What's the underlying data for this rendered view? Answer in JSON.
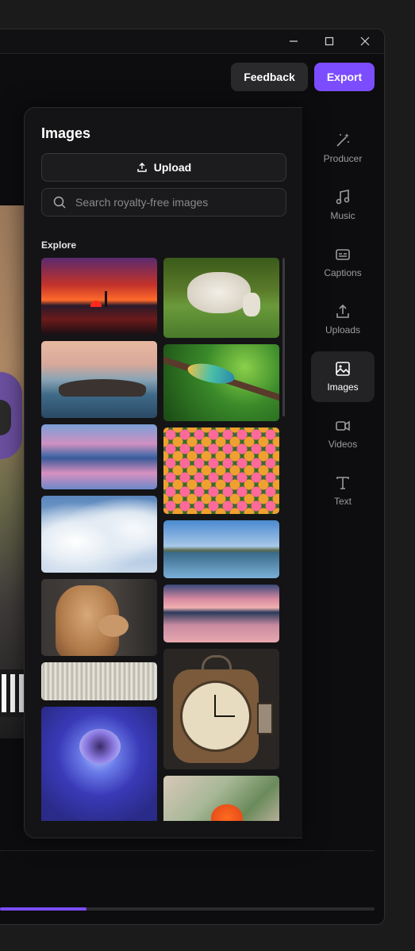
{
  "window_controls": {
    "minimize_icon": "minimize-icon",
    "maximize_icon": "maximize-icon",
    "close_icon": "close-icon"
  },
  "header": {
    "feedback_label": "Feedback",
    "export_label": "Export",
    "accent_color": "#7c4dff"
  },
  "images_panel": {
    "title": "Images",
    "upload_label": "Upload",
    "search_placeholder": "Search royalty-free images",
    "section_label": "Explore",
    "images": [
      {
        "name": "image-sunset-lighthouse"
      },
      {
        "name": "image-sheep-grazing"
      },
      {
        "name": "image-rocky-island-sea"
      },
      {
        "name": "image-chameleon-branch"
      },
      {
        "name": "image-lake-reflection-dusk"
      },
      {
        "name": "image-tulip-field"
      },
      {
        "name": "image-clouds-sky"
      },
      {
        "name": "image-lake-mountains"
      },
      {
        "name": "image-alpaca"
      },
      {
        "name": "image-pink-lake-sunset"
      },
      {
        "name": "image-abstract-symmetry"
      },
      {
        "name": "image-vintage-clock"
      },
      {
        "name": "image-blue-rose"
      },
      {
        "name": "image-orange-flower"
      }
    ]
  },
  "sidebar": {
    "items": [
      {
        "label": "Producer",
        "icon": "magic-wand-icon"
      },
      {
        "label": "Music",
        "icon": "music-note-icon"
      },
      {
        "label": "Captions",
        "icon": "captions-icon"
      },
      {
        "label": "Uploads",
        "icon": "upload-icon"
      },
      {
        "label": "Images",
        "icon": "image-icon",
        "active": true
      },
      {
        "label": "Videos",
        "icon": "video-camera-icon"
      },
      {
        "label": "Text",
        "icon": "text-icon"
      }
    ]
  },
  "timeline": {
    "progress": 0.23
  }
}
